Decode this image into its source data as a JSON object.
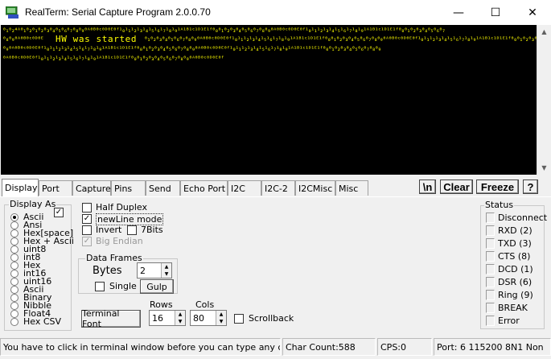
{
  "window": {
    "title": "RealTerm: Serial Capture Program 2.0.0.70",
    "minimize": "—",
    "maximize": "☐",
    "close": "✕"
  },
  "terminal": {
    "lines": [
      "⁰₁⁰₂⁴ᴬ⁰₁⁰₂⁰₁⁰₂⁰₃⁰₄⁰₅⁰₆⁰₇⁰₈⁰₉⁰ᴬ⁰ᴮ⁰ᶜ⁰ᴰ⁰ᴱ⁰ᶠ¹₀¹₁¹₂¹₃¹₄¹₅¹₆¹₇¹₈¹₉¹ᴬ¹ᴮ¹ᶜ¹ᴰ¹ᴱ¹ᶠ⁰₀⁰₁⁰₂⁰₃⁰₄⁰₅⁰₆⁰₇⁰₈⁰₉⁰ᴬ⁰ᴮ⁰ᶜ⁰ᴰ⁰ᴱ⁰ᶠ¹₀¹₁¹₂¹₃¹₄¹₅¹₆¹₇¹₈¹₉¹ᴬ¹ᴮ¹ᶜ¹ᴰ¹ᴱ¹ᶠ⁰₀⁰₁⁰₂⁰₃⁰₄⁰₅⁰₆⁰₇",
      "⁰₈⁰₉⁰ᴬ⁰ᴮ⁰ᶜ⁰ᴰ⁰ᴱ",
      "HW was started",
      "⁰₁⁰₂⁰₃⁰₄⁰₅⁰₆⁰₇⁰₈⁰₉⁰ᴬ⁰ᴮ⁰ᶜ⁰ᴰ⁰ᴱ⁰ᶠ¹₀¹₁¹₂¹₃¹₄¹₅¹₆¹₇¹₈¹₉¹ᴬ¹ᴮ¹ᶜ¹ᴰ¹ᴱ¹ᶠ⁰₀⁰₁⁰₂⁰₃⁰₄⁰₅⁰₆⁰₇⁰₈⁰₉⁰ᴬ⁰ᴮ⁰ᶜ⁰ᴰ⁰ᴱ⁰ᶠ¹₀¹₁¹₂¹₃¹₄¹₅¹₆¹₇¹₈¹₉¹ᴬ¹ᴮ¹ᶜ¹ᴰ¹ᴱ¹ᶠ⁰₀⁰₁⁰₂⁰₃⁰₄⁰₅⁰₆⁰₇⁰₈",
      "⁰₉⁰ᴬ⁰ᴮ⁰ᶜ⁰ᴰ⁰ᴱ⁰ᶠ¹₀¹₁¹₂¹₃¹₄¹₅¹₆¹₇¹₈¹₉¹ᴬ¹ᴮ¹ᶜ¹ᴰ¹ᴱ¹ᶠ⁰₀⁰₁⁰₂⁰₃⁰₄⁰₅⁰₆⁰₇⁰₈⁰₉⁰ᴬ⁰ᴮ⁰ᶜ⁰ᴰ⁰ᴱ⁰ᶠ¹₀¹₁¹₂¹₃¹₄¹₅¹₆¹₇¹₈¹₉¹ᴬ¹ᴮ¹ᶜ¹ᴰ¹ᴱ¹ᶠ⁰₀⁰₁⁰₂⁰₃⁰₄⁰₅⁰₆⁰₇⁰₈⁰₉",
      "⁰ᴬ⁰ᴮ⁰ᶜ⁰ᴰ⁰ᴱ⁰ᶠ¹₀¹₁¹₂¹₃¹₄¹₅¹₆¹₇¹₈¹₉¹ᴬ¹ᴮ¹ᶜ¹ᴰ¹ᴱ¹ᶠ⁰₀⁰₁⁰₂⁰₃⁰₄⁰₅⁰₆⁰₇⁰₈⁰₉⁰ᴬ⁰ᴮ⁰ᶜ⁰ᴰ⁰ᴱ⁰ᶠ"
    ],
    "text_color": "#ffff00",
    "background": "#000000"
  },
  "tabs": [
    "Display",
    "Port",
    "Capture",
    "Pins",
    "Send",
    "Echo Port",
    "I2C",
    "I2C-2",
    "I2CMisc",
    "Misc"
  ],
  "active_tab": "Display",
  "toolbar": {
    "newline_button": "\\n",
    "clear_button": "Clear",
    "freeze_button": "Freeze",
    "help_button": "?"
  },
  "display_as": {
    "label": "Display As",
    "options": [
      "Ascii",
      "Ansi",
      "Hex[space]",
      "Hex + Ascii",
      "uint8",
      "int8",
      "Hex",
      "int16",
      "uint16",
      "Ascii",
      "Binary",
      "Nibble",
      "Float4",
      "Hex CSV"
    ],
    "selected": "Ascii",
    "checkbox_checked": true
  },
  "options": {
    "half_duplex": {
      "label": "Half Duplex",
      "checked": false
    },
    "newline_mode": {
      "label": "newLine mode",
      "checked": true
    },
    "invert": {
      "label": "Invert",
      "checked": false
    },
    "seven_bits": {
      "label": "7Bits",
      "checked": false
    },
    "big_endian": {
      "label": "Big Endian",
      "checked": true,
      "disabled": true
    }
  },
  "data_frames": {
    "label": "Data Frames",
    "bytes_label": "Bytes",
    "bytes_value": "2",
    "single_label": "Single",
    "single_checked": false,
    "gulp_button": "Gulp"
  },
  "terminal_settings": {
    "font_button": "Terminal Font",
    "rows_label": "Rows",
    "rows_value": "16",
    "cols_label": "Cols",
    "cols_value": "80",
    "scrollback_label": "Scrollback",
    "scrollback_checked": false
  },
  "status": {
    "label": "Status",
    "items": [
      "Disconnect",
      "RXD (2)",
      "TXD (3)",
      "CTS (8)",
      "DCD (1)",
      "DSR (6)",
      "Ring (9)",
      "BREAK",
      "Error"
    ]
  },
  "statusbar": {
    "message": "You have to click in terminal window before you can type any cha",
    "char_count": "Char Count:588",
    "cps": "CPS:0",
    "port": "Port: 6 115200 8N1 Non"
  }
}
